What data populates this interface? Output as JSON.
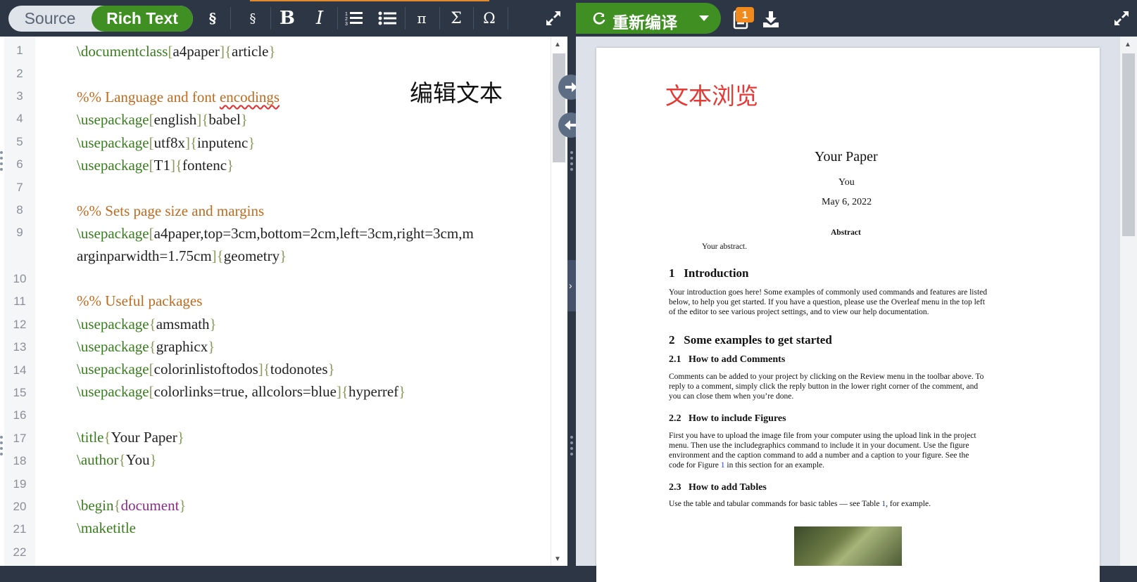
{
  "editor_toolbar": {
    "mode_source": "Source",
    "mode_rich": "Rich Text",
    "btn_section": "§",
    "btn_subsection": "§",
    "btn_bold": "B",
    "btn_italic": "I",
    "btn_pi": "π",
    "btn_sigma": "Σ",
    "btn_omega": "Ω"
  },
  "editor": {
    "line_numbers": [
      "1",
      "2",
      "3",
      "4",
      "5",
      "6",
      "7",
      "8",
      "9",
      "10",
      "11",
      "12",
      "13",
      "14",
      "15",
      "16",
      "17",
      "18",
      "19",
      "20",
      "21",
      "22"
    ],
    "lines": {
      "l1": {
        "cmd": "\\documentclass",
        "o1": "[",
        "a1": "a4paper",
        "c1": "]",
        "o2": "{",
        "a2": "article",
        "c2": "}"
      },
      "l3": {
        "comment_a": "%% Language and font ",
        "comment_b": "encodings"
      },
      "l4": {
        "cmd": "\\usepackage",
        "o1": "[",
        "a1": "english",
        "c1": "]",
        "o2": "{",
        "a2": "babel",
        "c2": "}"
      },
      "l5": {
        "cmd": "\\usepackage",
        "o1": "[",
        "a1": "utf8x",
        "c1": "]",
        "o2": "{",
        "a2": "inputenc",
        "c2": "}"
      },
      "l6": {
        "cmd": "\\usepackage",
        "o1": "[",
        "a1": "T1",
        "c1": "]",
        "o2": "{",
        "a2": "fontenc",
        "c2": "}"
      },
      "l8": {
        "comment": "%% Sets page size and margins"
      },
      "l9": {
        "cmd": "\\usepackage",
        "o1": "[",
        "a1": "a4paper,top=3cm,bottom=2cm,left=3cm,right=3cm,m"
      },
      "l9b": {
        "a1": "arginparwidth=1.75cm",
        "c1": "]",
        "o2": "{",
        "a2": "geometry",
        "c2": "}"
      },
      "l11": {
        "comment": "%% Useful packages"
      },
      "l12": {
        "cmd": "\\usepackage",
        "o2": "{",
        "a2": "amsmath",
        "c2": "}"
      },
      "l13": {
        "cmd": "\\usepackage",
        "o2": "{",
        "a2": "graphicx",
        "c2": "}"
      },
      "l14": {
        "cmd": "\\usepackage",
        "o1": "[",
        "a1": "colorinlistoftodos",
        "c1": "]",
        "o2": "{",
        "a2": "todonotes",
        "c2": "}"
      },
      "l15": {
        "cmd": "\\usepackage",
        "o1": "[",
        "a1": "colorlinks=true, allcolors=blue",
        "c1": "]",
        "o2": "{",
        "a2": "hyperref",
        "c2": "}"
      },
      "l17": {
        "cmd": "\\title",
        "o2": "{",
        "a2": "Your Paper",
        "c2": "}"
      },
      "l18": {
        "cmd": "\\author",
        "o2": "{",
        "a2": "You",
        "c2": "}"
      },
      "l20": {
        "cmd": "\\begin",
        "o2": "{",
        "a2": "document",
        "c2": "}"
      },
      "l21": {
        "cmd": "\\maketitle"
      }
    },
    "overlay_label": "编辑文本"
  },
  "preview_toolbar": {
    "recompile_label": "重新编译",
    "badge_count": "1"
  },
  "preview": {
    "overlay_label": "文本浏览",
    "title": "Your Paper",
    "author": "You",
    "date": "May 6, 2022",
    "abstract_heading": "Abstract",
    "abstract_text": "Your abstract.",
    "s1_num": "1",
    "s1_title": "Introduction",
    "s1_p1": "Your introduction goes here! Some examples of commonly used commands and features are listed",
    "s1_p2": "below, to help you get started. If you have a question, please use the Overleaf menu in the top left",
    "s1_p3": "of the editor to see various project settings, and to view our help documentation.",
    "s2_num": "2",
    "s2_title": "Some examples to get started",
    "s21_num": "2.1",
    "s21_title": "How to add Comments",
    "s21_p1": "Comments can be added to your project by clicking on the Review menu in the toolbar above. To",
    "s21_p2": "reply to a comment, simply click the reply button in the lower right corner of the comment, and",
    "s21_p3": "you can close them when you’re done.",
    "s22_num": "2.2",
    "s22_title": "How to include Figures",
    "s22_p1": "First you have to upload the image file from your computer using the upload link in the project",
    "s22_p2": "menu. Then use the includegraphics command to include it in your document. Use the figure",
    "s22_p3": "environment and the caption command to add a number and a caption to your figure. See the",
    "s22_p4a": "code for Figure ",
    "s22_p4ref": "1",
    "s22_p4b": " in this section for an example.",
    "s23_num": "2.3",
    "s23_title": "How to add Tables",
    "s23_p1a": "Use the table and tabular commands for basic tables — see Table ",
    "s23_p1ref": "1",
    "s23_p1b": ", for example."
  },
  "colors": {
    "toolbar_bg": "#2c3645",
    "accent_green": "#3f8f22",
    "badge_orange": "#f08a1c",
    "latex_command": "#3a7d1f",
    "latex_comment": "#c06a1e",
    "overlay_red": "#e53935",
    "link_blue": "#1a3ccf"
  }
}
